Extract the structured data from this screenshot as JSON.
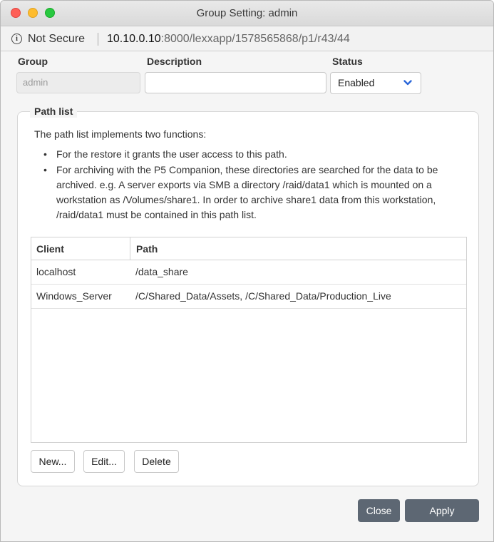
{
  "window": {
    "title": "Group Setting: admin"
  },
  "address_bar": {
    "security_label": "Not Secure",
    "host": "10.10.0.10",
    "rest": ":8000/lexxapp/1578565868/p1/r43/44"
  },
  "form": {
    "group_label": "Group",
    "group_value": "admin",
    "description_label": "Description",
    "description_value": "",
    "status_label": "Status",
    "status_value": "Enabled"
  },
  "path_list": {
    "legend": "Path list",
    "intro": "The path list implements two functions:",
    "bullets": [
      "For the restore it grants the user access to this path.",
      "For archiving with the P5 Companion, these directories are searched for the data to be archived. e.g. A server exports via SMB a directory /raid/data1 which is mounted on a workstation as /Volumes/share1. In order to archive share1 data from this workstation, /raid/data1 must be contained in this path list."
    ],
    "columns": {
      "client": "Client",
      "path": "Path"
    },
    "rows": [
      {
        "client": "localhost",
        "path": "/data_share"
      },
      {
        "client": "Windows_Server",
        "path": "/C/Shared_Data/Assets, /C/Shared_Data/Production_Live"
      }
    ],
    "buttons": {
      "new": "New...",
      "edit": "Edit...",
      "delete": "Delete"
    }
  },
  "footer": {
    "close": "Close",
    "apply": "Apply"
  },
  "colors": {
    "primary_button": "#5d6773",
    "select_chevron": "#2a66d9"
  },
  "icons": [
    "info-icon",
    "chevron-down-icon"
  ]
}
